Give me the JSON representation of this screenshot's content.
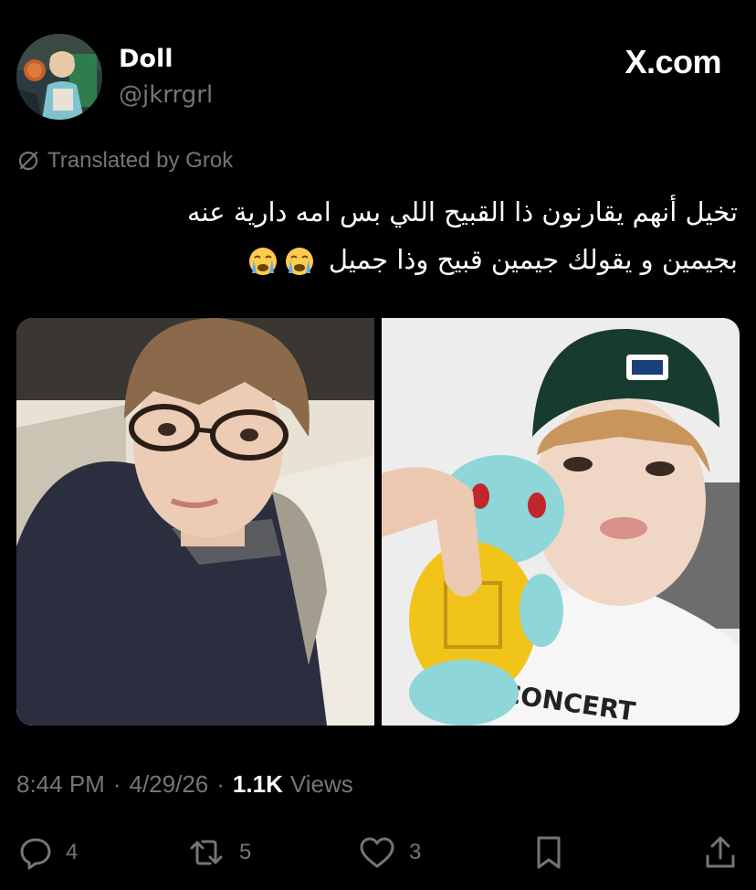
{
  "author": {
    "display_name": "Doll",
    "handle": "@jkrrgrl"
  },
  "brand": "X.com",
  "translation_note": "Translated by Grok",
  "tweet": {
    "line1": "تخيل أنهم يقارنون ذا القبيح اللي بس امه دارية عنه",
    "line2": "بجيمين و يقولك جيمين قبيح وذا جميل",
    "emojis": [
      "loudly-crying-face",
      "loudly-crying-face"
    ]
  },
  "media": [
    {
      "icon": "photo-glasses-navy-sweater"
    },
    {
      "icon": "photo-green-cap-squirtle-plush"
    }
  ],
  "meta": {
    "time": "8:44 PM",
    "date": "4/29/26",
    "views_count": "1.1K",
    "views_label": "Views"
  },
  "actions": {
    "replies": "4",
    "reposts": "5",
    "likes": "3"
  },
  "colors": {
    "background": "#000000",
    "text": "#ffffff",
    "secondary": "#71767b"
  }
}
